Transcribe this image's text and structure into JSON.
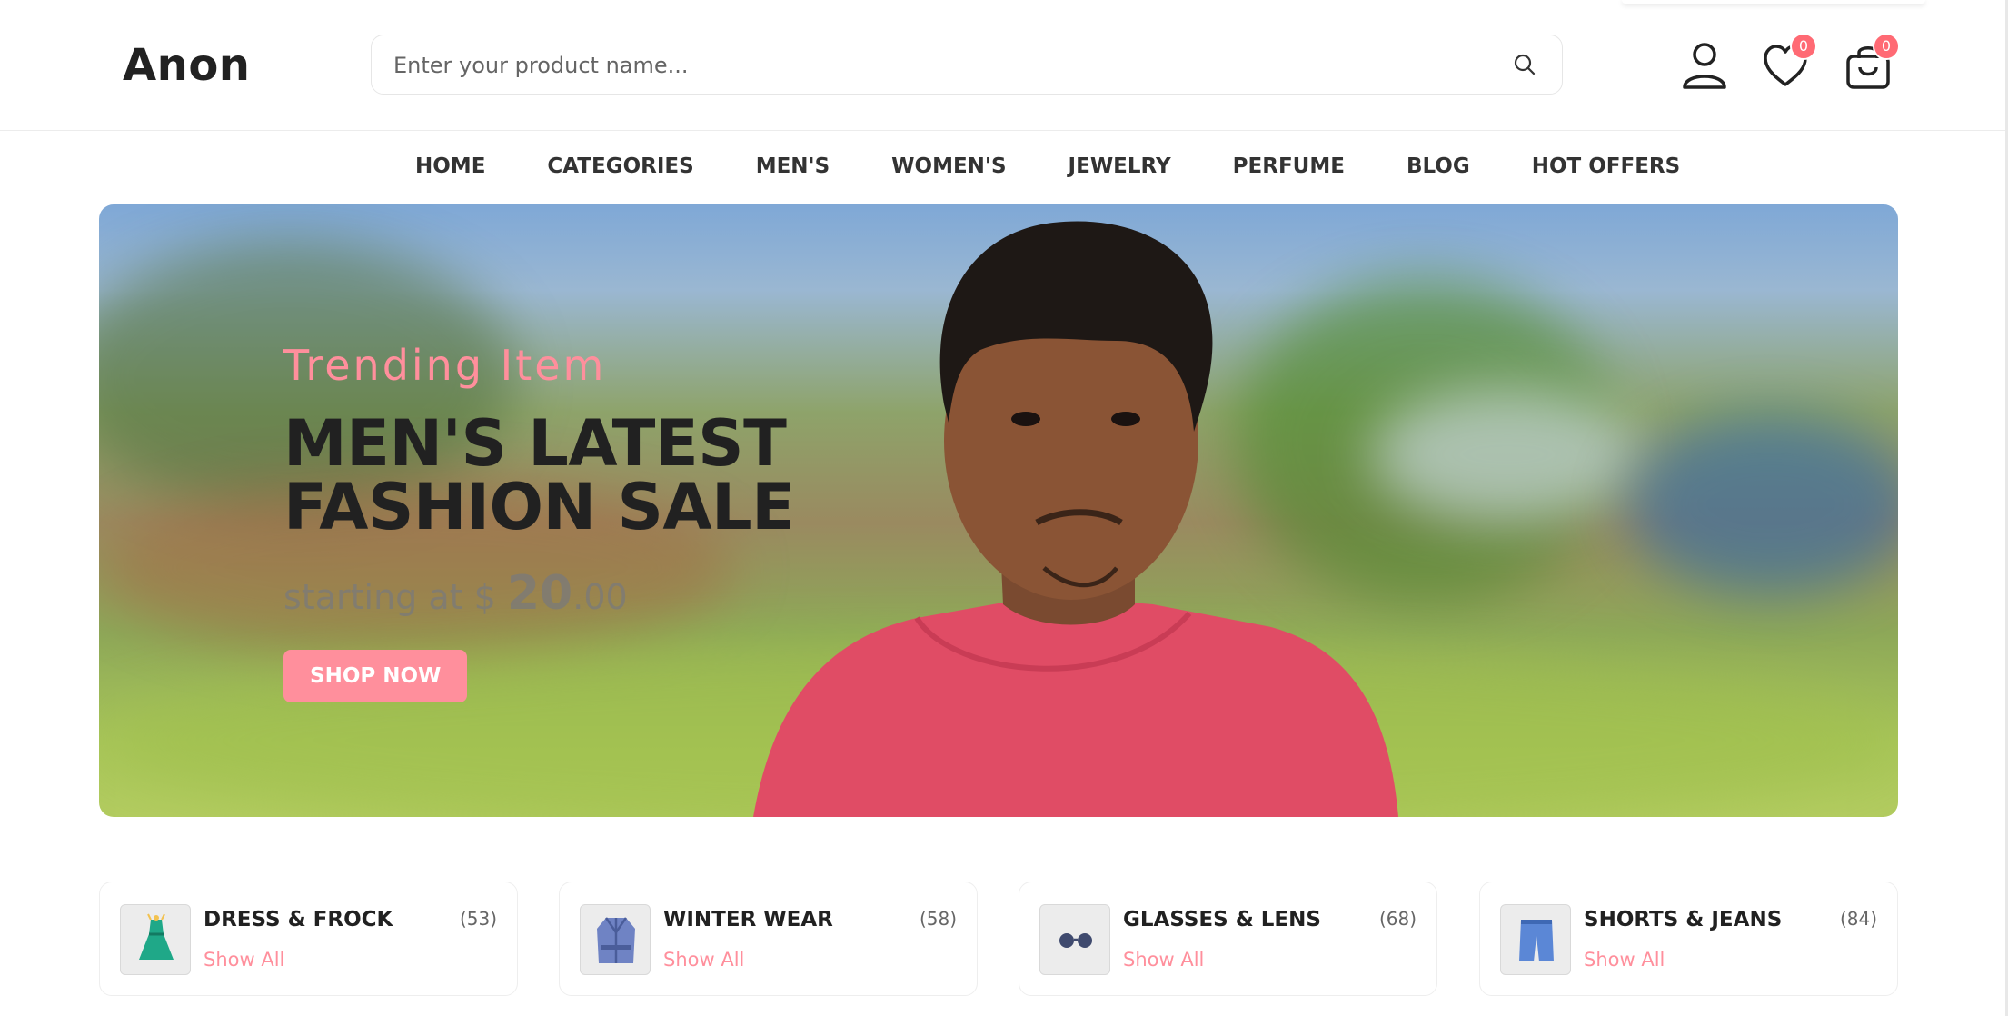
{
  "header": {
    "logo": "Anon",
    "search": {
      "placeholder": "Enter your product name..."
    },
    "wishlist_count": "0",
    "cart_count": "0"
  },
  "nav": {
    "items": [
      "HOME",
      "CATEGORIES",
      "MEN'S",
      "WOMEN'S",
      "JEWELRY",
      "PERFUME",
      "BLOG",
      "HOT OFFERS"
    ]
  },
  "banner": {
    "subtitle": "Trending Item",
    "title_line1": "MEN'S LATEST",
    "title_line2": "FASHION SALE",
    "price_prefix": "starting at $ ",
    "price_whole": "20",
    "price_cents": ".00",
    "button": "SHOP NOW"
  },
  "categories": [
    {
      "name": "DRESS & FROCK",
      "count": "(53)",
      "link": "Show All",
      "icon": "dress-icon"
    },
    {
      "name": "WINTER WEAR",
      "count": "(58)",
      "link": "Show All",
      "icon": "coat-icon"
    },
    {
      "name": "GLASSES & LENS",
      "count": "(68)",
      "link": "Show All",
      "icon": "glasses-icon"
    },
    {
      "name": "SHORTS & JEANS",
      "count": "(84)",
      "link": "Show All",
      "icon": "shorts-icon"
    }
  ],
  "colors": {
    "accent": "#ff8f9c",
    "badge": "#ff6a74",
    "text": "#212121"
  }
}
